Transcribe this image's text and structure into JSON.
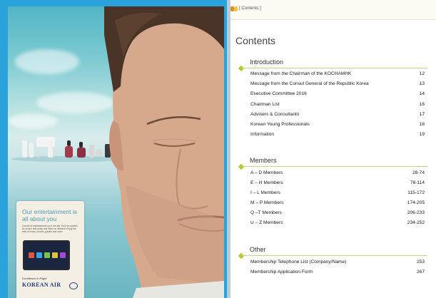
{
  "ad": {
    "headline": "Our entertainment is all about you",
    "body": "A world of entertainment up in the sky. You'll be spoiled for choice with audio and video on demand. Enjoy the best of music, movies, games and more.",
    "tagline": "Excellence in Flight",
    "brand": "KOREAN AIR"
  },
  "header": {
    "crumb": "[ Contents ]"
  },
  "page_title": "Contents",
  "sections": [
    {
      "title": "Introduction",
      "entries": [
        {
          "label": "Message from the Chairman of the KOCHAMHK",
          "page": "12"
        },
        {
          "label": "Message from the Consul General of the Republic Korea",
          "page": "13"
        },
        {
          "label": "Executive Committee 2016",
          "page": "14"
        },
        {
          "label": "Chairman List",
          "page": "16"
        },
        {
          "label": "Advisers & Consultants",
          "page": "17"
        },
        {
          "label": "Korean Young Professionals",
          "page": "18"
        },
        {
          "label": "Information",
          "page": "19"
        }
      ]
    },
    {
      "title": "Members",
      "entries": [
        {
          "label": "A – D Members",
          "page": "28-74"
        },
        {
          "label": "E – H Members",
          "page": "76-114"
        },
        {
          "label": "I – L Members",
          "page": "115-172"
        },
        {
          "label": "M – P Members",
          "page": "174-205"
        },
        {
          "label": "Q –T Members",
          "page": "206-233"
        },
        {
          "label": "U – Z Members",
          "page": "234-252"
        }
      ]
    },
    {
      "title": "Other",
      "entries": [
        {
          "label": "Membership Telephone List (Company/Name)",
          "page": "253"
        },
        {
          "label": "Membership Application Form",
          "page": "267"
        }
      ]
    }
  ],
  "colors": {
    "accent": "#b6c83a",
    "ad_border": "#2aa3dd",
    "crumb_dot_1": "#e08a2a",
    "crumb_dot_2": "#f0c34a"
  }
}
